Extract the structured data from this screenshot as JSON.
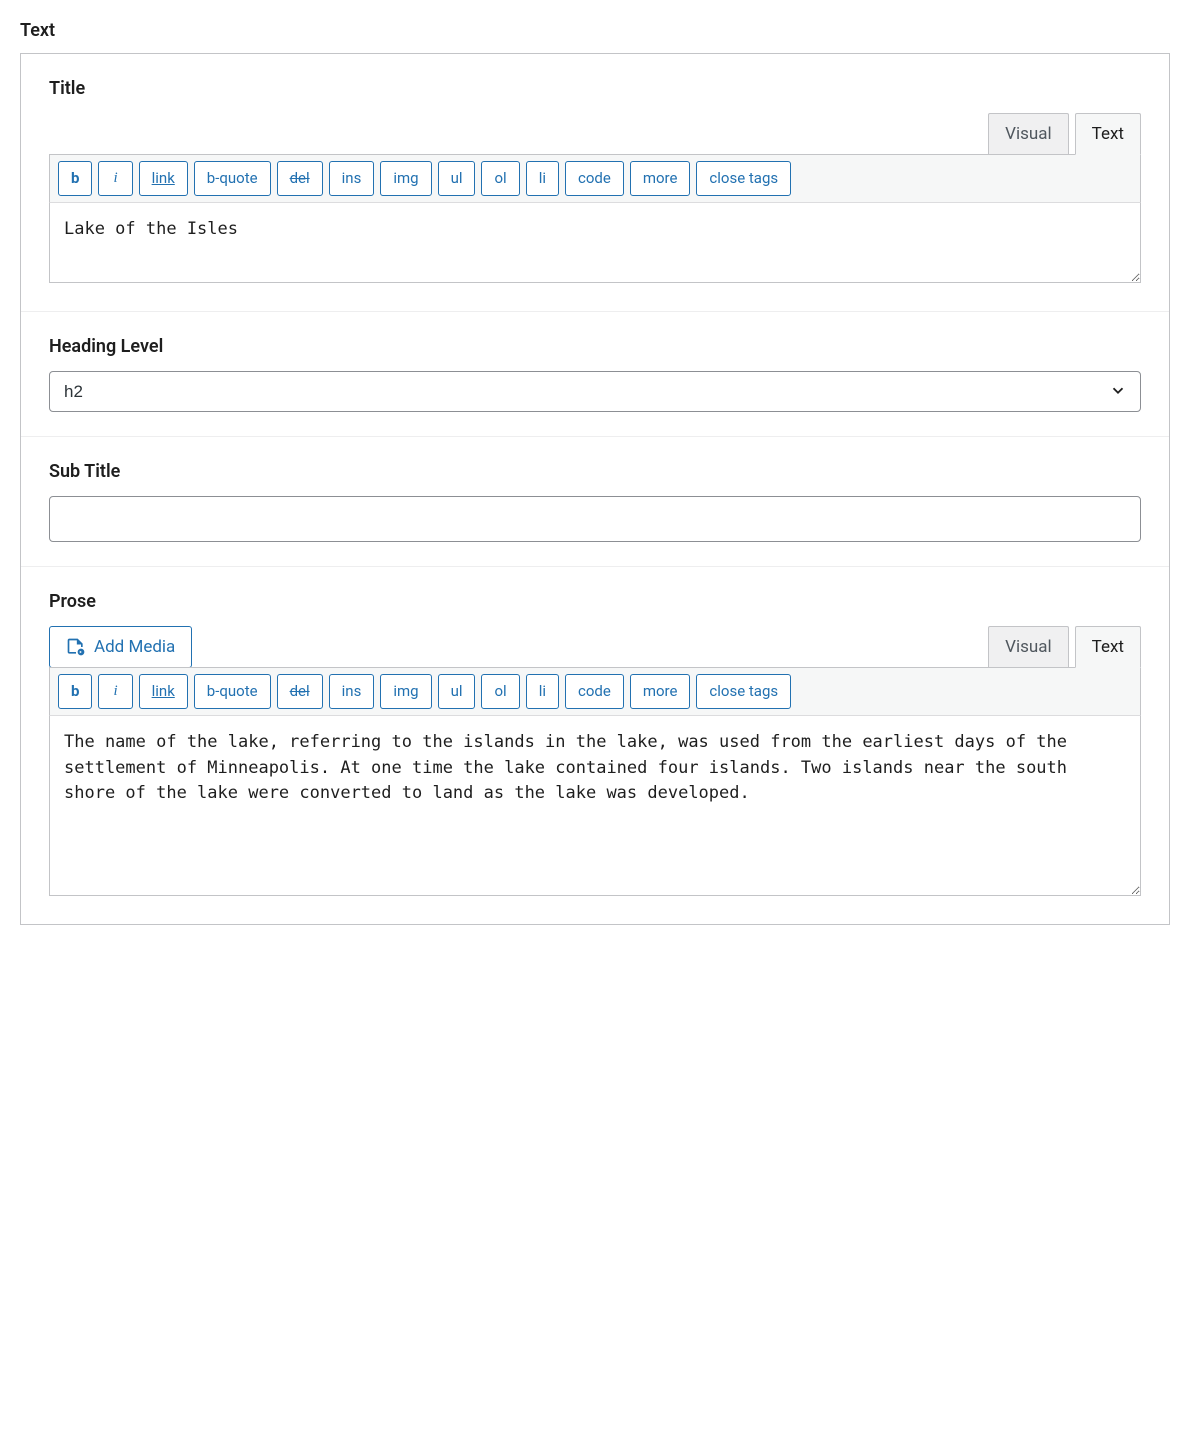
{
  "section_header": "Text",
  "editorTabs": {
    "visual": "Visual",
    "text": "Text"
  },
  "toolbar": {
    "b": "b",
    "i": "i",
    "link": "link",
    "bquote": "b-quote",
    "del": "del",
    "ins": "ins",
    "img": "img",
    "ul": "ul",
    "ol": "ol",
    "li": "li",
    "code": "code",
    "more": "more",
    "close": "close tags"
  },
  "addMedia": "Add Media",
  "fields": {
    "title": {
      "label": "Title",
      "value": "Lake of the Isles"
    },
    "headingLevel": {
      "label": "Heading Level",
      "value": "h2"
    },
    "subTitle": {
      "label": "Sub Title",
      "value": ""
    },
    "prose": {
      "label": "Prose",
      "value": "The name of the lake, referring to the islands in the lake, was used from the earliest days of the settlement of Minneapolis. At one time the lake contained four islands. Two islands near the south shore of the lake were converted to land as the lake was developed."
    }
  }
}
